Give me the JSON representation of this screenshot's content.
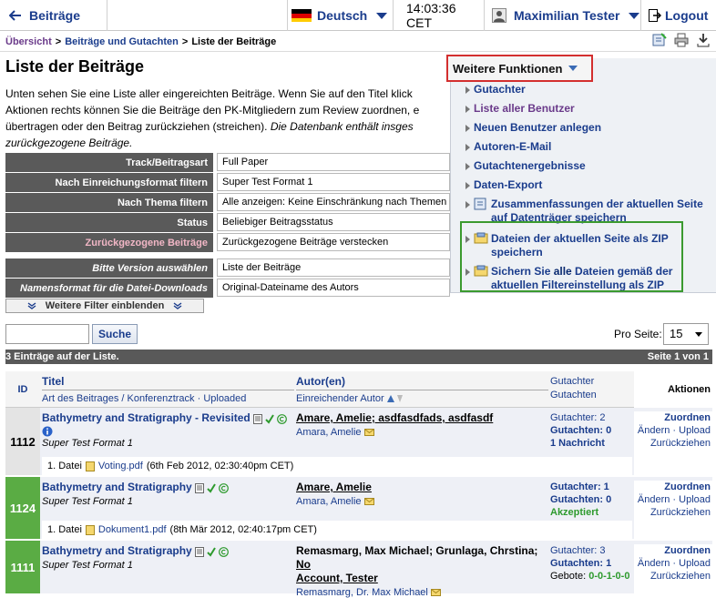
{
  "topbar": {
    "back_label": "Beiträge",
    "language": "Deutsch",
    "time": "14:03:36 CET",
    "user": "Maximilian Tester",
    "logout": "Logout"
  },
  "breadcrumb": {
    "items": [
      "Übersicht",
      "Beiträge und Gutachten",
      "Liste der Beiträge"
    ]
  },
  "page": {
    "title": "Liste der Beiträge",
    "intro_lines": [
      "Unten sehen Sie eine Liste aller eingereichten Beiträge. Wenn Sie auf den Titel klick",
      "Aktionen rechts können Sie die Beiträge den PK-Mitgliedern zum Review zuordnen, e",
      "übertragen oder den Beitrag zurückziehen (streichen). Die Datenbank enthält insges",
      "zurückgezogene Beiträge."
    ],
    "intro_line3_plain": "übertragen oder den Beitrag zurückziehen (streichen). ",
    "intro_line3_italic": "Die Datenbank enthält insges"
  },
  "filters": [
    {
      "label": "Track/Beitragsart",
      "value": "Full Paper"
    },
    {
      "label": "Nach Einreichungsformat filtern",
      "value": "Super Test Format 1"
    },
    {
      "label": "Nach Thema filtern",
      "value": "Alle anzeigen: Keine Einschränkung nach Themen"
    },
    {
      "label": "Status",
      "value": "Beliebiger Beitragsstatus"
    },
    {
      "label": "Zurückgezogene Beiträge",
      "value": "Zurückgezogene Beiträge verstecken"
    },
    {
      "label": "Bitte Version auswählen",
      "value": "Liste der Beiträge"
    },
    {
      "label": "Namensformat für die Datei-Downloads",
      "value": "Original-Dateiname des Autors"
    }
  ],
  "more_filters_label": "Weitere Filter einblenden",
  "weitere": {
    "button": "Weitere Funktionen",
    "items": [
      "Gutachter",
      "Liste aller Benutzer",
      "Neuen Benutzer anlegen",
      "Autoren-E-Mail",
      "Gutachtenergebnisse",
      "Daten-Export",
      "Zusammenfassungen der aktuellen Seite auf Datenträger speichern",
      "Dateien der aktuellen Seite als ZIP speichern"
    ],
    "last_item_pre": "Sichern Sie ",
    "last_item_bold": "alle",
    "last_item_post": " Dateien gemäß der aktuellen Filtereinstellung als ZIP"
  },
  "search": {
    "button": "Suche",
    "value": ""
  },
  "perpage": {
    "label": "Pro Seite:",
    "value": "15"
  },
  "countbar": {
    "left": "3 Einträge auf der Liste.",
    "right": "Seite 1 von 1"
  },
  "table": {
    "headers": {
      "id": "ID",
      "title": "Titel",
      "title_sub1": "Art des Beitrages / Konferenztrack",
      "title_sub2": "Uploaded",
      "author": "Autor(en)",
      "author_sub": "Einreichender Autor",
      "rev1": "Gutachter",
      "rev2": "Gutachten",
      "actions": "Aktionen"
    },
    "rows": [
      {
        "id": "1112",
        "title": "Bathymetry and Stratigraphy - Revisited",
        "format": "Super Test Format 1",
        "authors": "Amare, Amelie; asdfasdfads, asdfasdf",
        "submitter": "Amara, Amelie",
        "rev_a": "Gutachter: 2",
        "rev_b": "Gutachten: 0",
        "rev_c": "1 Nachricht",
        "act1": "Zuordnen",
        "act2a": "Ändern",
        "act2b": "Upload",
        "act3": "Zurückziehen",
        "file_prefix": "1. Datei",
        "file_name": "Voting.pdf",
        "file_date": "(6th Feb 2012, 02:30:40pm CET)"
      },
      {
        "id": "1124",
        "title": "Bathymetry and Stratigraphy",
        "format": "Super Test Format 1",
        "authors": "Amare, Amelie",
        "submitter": "Amara, Amelie",
        "rev_a": "Gutachter: 1",
        "rev_b": "Gutachten: 0",
        "rev_c": "Akzeptiert",
        "act1": "Zuordnen",
        "act2a": "Ändern",
        "act2b": "Upload",
        "act3": "Zurückziehen",
        "file_prefix": "1. Datei",
        "file_name": "Dokument1.pdf",
        "file_date": "(8th Mär 2012, 02:40:17pm CET)"
      },
      {
        "id": "1111",
        "title": "Bathymetry and Stratigraphy",
        "format": "Super Test Format 1",
        "authors_plain": "Remasmarg, Max Michael; Grunlaga, Chrstina; ",
        "authors_ul1": "No",
        "authors_ul2": "Account, Tester",
        "submitter": "Remasmarg, Dr. Max Michael",
        "rev_a": "Gutachter: 3",
        "rev_b": "Gutachten: 1",
        "rev_c_label": "Gebote: ",
        "rev_c_values": "0-0-1-0-0",
        "act1": "Zuordnen",
        "act2a": "Ändern",
        "act2b": "Upload",
        "act3": "Zurückziehen"
      }
    ]
  },
  "colors": {
    "accent_red": "#d32f2f",
    "accent_green": "#3b9a2f",
    "link": "#1a3c8c",
    "row_id_green": "#5aac44"
  }
}
